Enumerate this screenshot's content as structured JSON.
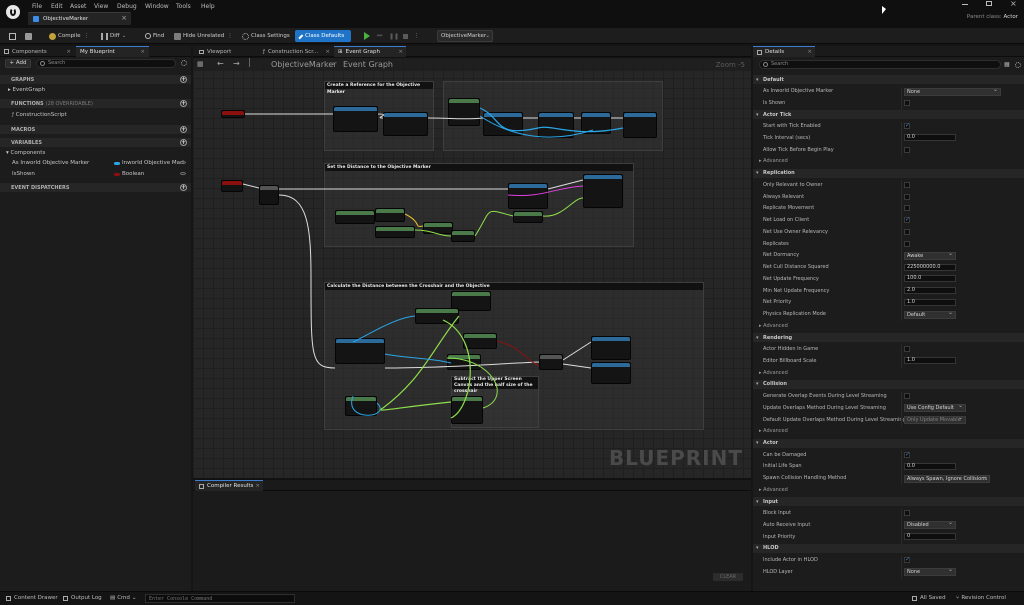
{
  "menu": [
    "File",
    "Edit",
    "Asset",
    "View",
    "Debug",
    "Window",
    "Tools",
    "Help"
  ],
  "document_tab": "ObjectiveMarker",
  "parent_class": {
    "label": "Parent class:",
    "value": "Actor"
  },
  "toolbar": {
    "compile": "Compile",
    "diff": "Diff",
    "find": "Find",
    "hide_unrelated": "Hide Unrelated",
    "class_settings": "Class Settings",
    "class_defaults": "Class Defaults",
    "debug_object": "ObjectiveMarker"
  },
  "left_panel": {
    "tabs": [
      "Components",
      "My Blueprint"
    ],
    "add_button": "+ Add",
    "search_placeholder": "Search",
    "sections": {
      "graphs": "GRAPHS",
      "functions": "FUNCTIONS",
      "functions_count": "(28 OVERRIDABLE)",
      "macros": "MACROS",
      "variables": "VARIABLES",
      "event_dispatchers": "EVENT DISPATCHERS"
    },
    "graph_items": [
      "EventGraph"
    ],
    "function_items": [
      "ConstructionScript"
    ],
    "variable_category": "Components",
    "variables": [
      {
        "name": "As Inworld Objective Marker",
        "type": "Inworld Objective Marl",
        "color": "#2aa6e6"
      },
      {
        "name": "IsShown",
        "type": "Boolean",
        "color": "#8c0f0f"
      }
    ]
  },
  "center": {
    "tabs": [
      "Viewport",
      "Construction Scr...",
      "Event Graph"
    ],
    "breadcrumb": [
      "ObjectiveMarker",
      "Event Graph"
    ],
    "zoom": "Zoom -5",
    "watermark": "BLUEPRINT",
    "comments": [
      "Create a Reference for the Objective Marker",
      "Set the Distance to the Objective Marker",
      "Calculate the Distance between the Crosshair and the Objective",
      "Subtract the Upper Screen Canvas and the half size of the crosshair"
    ],
    "compiler_tab": "Compiler Results",
    "clear_button": "CLEAR"
  },
  "details": {
    "tab": "Details",
    "search_placeholder": "Search",
    "advanced": "Advanced",
    "sections": [
      {
        "title": "Default",
        "rows": [
          {
            "label": "As Inworld Objective Marker",
            "kind": "drop",
            "value": "None"
          },
          {
            "label": "Is Shown",
            "kind": "check",
            "on": false
          }
        ]
      },
      {
        "title": "Actor Tick",
        "rows": [
          {
            "label": "Start with Tick Enabled",
            "kind": "check",
            "on": true
          },
          {
            "label": "Tick Interval (secs)",
            "kind": "field",
            "value": "0.0"
          },
          {
            "label": "Allow Tick Before Begin Play",
            "kind": "check",
            "on": false
          }
        ]
      },
      {
        "title": "Replication",
        "rows": [
          {
            "label": "Only Relevant to Owner",
            "kind": "check",
            "on": false
          },
          {
            "label": "Always Relevant",
            "kind": "check",
            "on": false
          },
          {
            "label": "Replicate Movement",
            "kind": "check",
            "on": false
          },
          {
            "label": "Net Load on Client",
            "kind": "check",
            "on": true
          },
          {
            "label": "Net Use Owner Relevancy",
            "kind": "check",
            "on": false
          },
          {
            "label": "Replicates",
            "kind": "check",
            "on": false
          },
          {
            "label": "Net Dormancy",
            "kind": "drop",
            "value": "Awake"
          },
          {
            "label": "Net Cull Distance Squared",
            "kind": "field",
            "value": "225000000.0"
          },
          {
            "label": "Net Update Frequency",
            "kind": "field",
            "value": "100.0"
          },
          {
            "label": "Min Net Update Frequency",
            "kind": "field",
            "value": "2.0"
          },
          {
            "label": "Net Priority",
            "kind": "field",
            "value": "1.0"
          },
          {
            "label": "Physics Replication Mode",
            "kind": "drop",
            "value": "Default"
          }
        ]
      },
      {
        "title": "Rendering",
        "rows": [
          {
            "label": "Actor Hidden In Game",
            "kind": "check",
            "on": false
          },
          {
            "label": "Editor Billboard Scale",
            "kind": "field",
            "value": "1.0"
          }
        ]
      },
      {
        "title": "Collision",
        "rows": [
          {
            "label": "Generate Overlap Events During Level Streaming",
            "kind": "check",
            "on": false
          },
          {
            "label": "Update Overlaps Method During Level Streaming",
            "kind": "drop",
            "value": "Use Config Default"
          },
          {
            "label": "Default Update Overlaps Method During Level Streaming",
            "kind": "drop",
            "value": "Only Update Movable",
            "disabled": true
          }
        ]
      },
      {
        "title": "Actor",
        "rows": [
          {
            "label": "Can be Damaged",
            "kind": "check",
            "on": true
          },
          {
            "label": "Initial Life Span",
            "kind": "field",
            "value": "0.0"
          },
          {
            "label": "Spawn Collision Handling Method",
            "kind": "drop",
            "value": "Always Spawn, Ignore Collisions"
          }
        ]
      },
      {
        "title": "Input",
        "rows": [
          {
            "label": "Block Input",
            "kind": "check",
            "on": false
          },
          {
            "label": "Auto Receive Input",
            "kind": "drop",
            "value": "Disabled"
          },
          {
            "label": "Input Priority",
            "kind": "field",
            "value": "0"
          }
        ]
      },
      {
        "title": "HLOD",
        "rows": [
          {
            "label": "Include Actor in HLOD",
            "kind": "check",
            "on": true
          },
          {
            "label": "HLOD Layer",
            "kind": "drop",
            "value": "None"
          }
        ]
      }
    ]
  },
  "statusbar": {
    "content_drawer": "Content Drawer",
    "output_log": "Output Log",
    "cmd": "Cmd",
    "console_placeholder": "Enter Console Command",
    "all_saved": "All Saved",
    "revision_control": "Revision Control"
  }
}
